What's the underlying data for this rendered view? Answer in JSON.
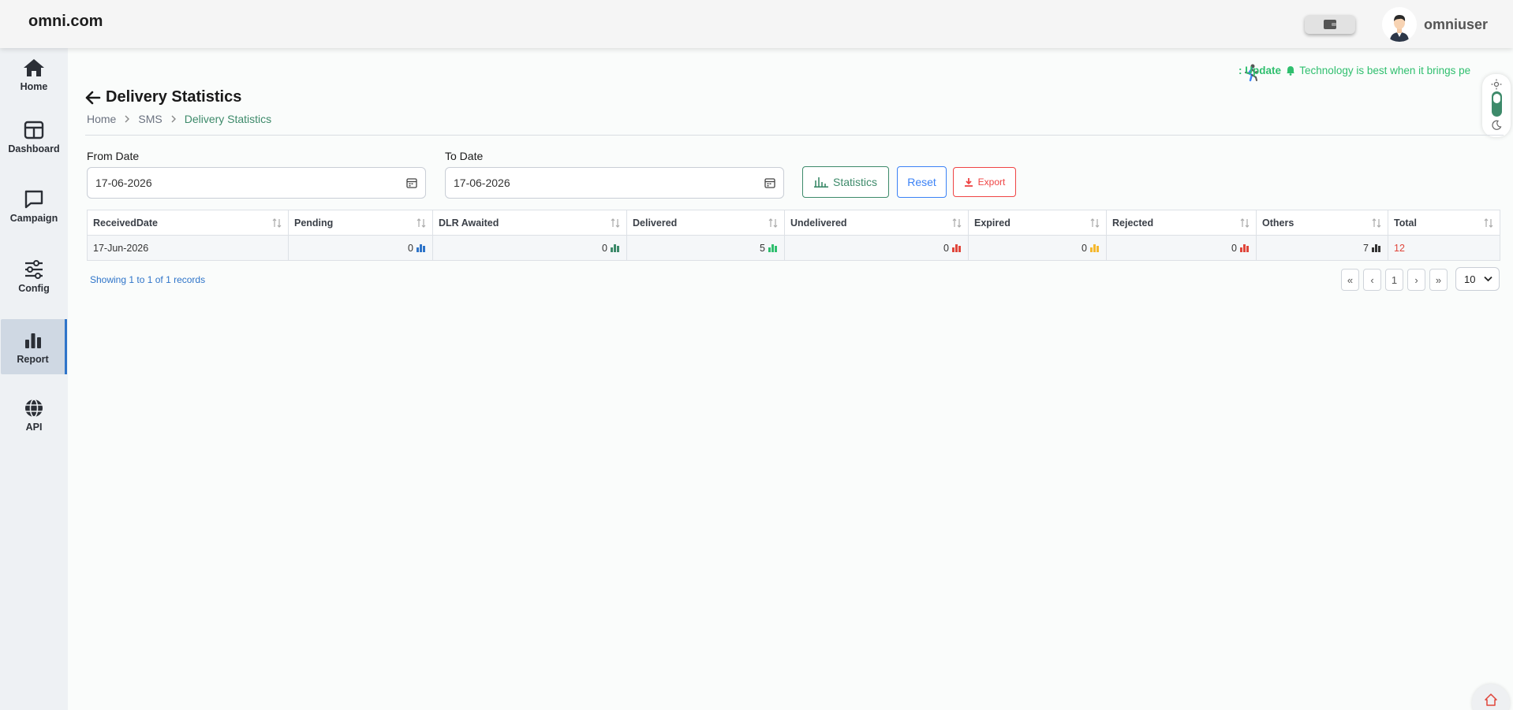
{
  "header": {
    "logo": "omni.com",
    "username": "omniuser"
  },
  "sidebar": {
    "items": [
      {
        "label": "Home",
        "icon": "home-icon"
      },
      {
        "label": "Dashboard",
        "icon": "dashboard-icon"
      },
      {
        "label": "Campaign",
        "icon": "chat-icon"
      },
      {
        "label": "Config",
        "icon": "sliders-icon"
      },
      {
        "label": "Report",
        "icon": "bar-chart-icon",
        "active": true
      },
      {
        "label": "API",
        "icon": "globe-icon"
      }
    ]
  },
  "marquee": {
    "label": ": Update",
    "text": "Technology is best when it brings pe"
  },
  "page": {
    "title": "Delivery Statistics",
    "breadcrumb": [
      "Home",
      "SMS",
      "Delivery Statistics"
    ]
  },
  "filters": {
    "from_label": "From Date",
    "from_value": "17-06-2026",
    "to_label": "To Date",
    "to_value": "17-06-2026",
    "statistics_label": "Statistics",
    "reset_label": "Reset",
    "export_label": "Export"
  },
  "table": {
    "columns": [
      "ReceivedDate",
      "Pending",
      "DLR Awaited",
      "Delivered",
      "Undelivered",
      "Expired",
      "Rejected",
      "Others",
      "Total"
    ],
    "rows": [
      {
        "received_date": "17-Jun-2026",
        "pending": "0",
        "dlr_awaited": "0",
        "delivered": "5",
        "undelivered": "0",
        "expired": "0",
        "rejected": "0",
        "others": "7",
        "total": "12"
      }
    ]
  },
  "colors": {
    "pending": "#2e74c9",
    "dlr_awaited": "#3d8a6a",
    "delivered": "#2fbf6e",
    "undelivered": "#e0463b",
    "expired": "#f5b82e",
    "rejected": "#e0463b",
    "others": "#333333",
    "accent": "#3d8a6a"
  },
  "footer": {
    "showing_text": "Showing 1 to 1 of 1 records",
    "pager": [
      "«",
      "‹",
      "1",
      "›",
      "»"
    ],
    "page_size": "10"
  }
}
